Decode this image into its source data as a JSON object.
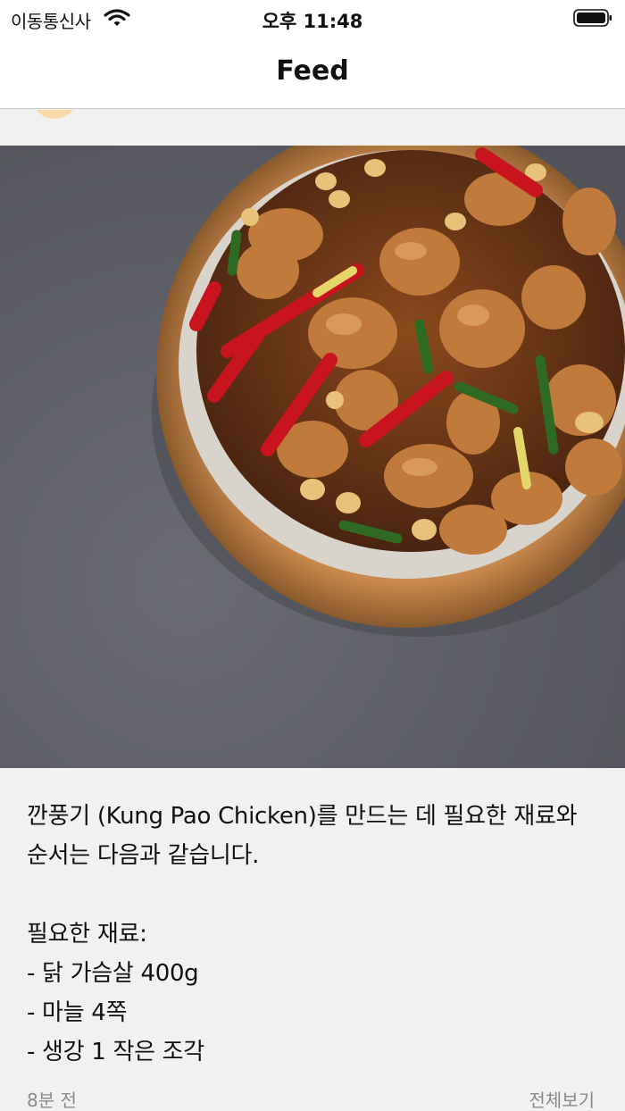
{
  "status_bar": {
    "carrier": "이동통신사",
    "time": "오후 11:48",
    "icons": [
      "wifi-icon",
      "battery-icon"
    ]
  },
  "nav": {
    "title": "Feed"
  },
  "post": {
    "image_alt": "kung-pao-chicken-photo",
    "text": "깐풍기 (Kung Pao Chicken)를 만드는 데 필요한 재료와 순서는 다음과 같습니다.\n\n필요한 재료:\n- 닭 가슴살 400g\n- 마늘 4쪽\n- 생강 1 작은 조각",
    "time_ago": "8분 전",
    "see_all": "전체보기"
  },
  "colors": {
    "nav_background": "#ffffff",
    "feed_background": "#f1f1f1",
    "meta_text": "#8a8a8a"
  }
}
